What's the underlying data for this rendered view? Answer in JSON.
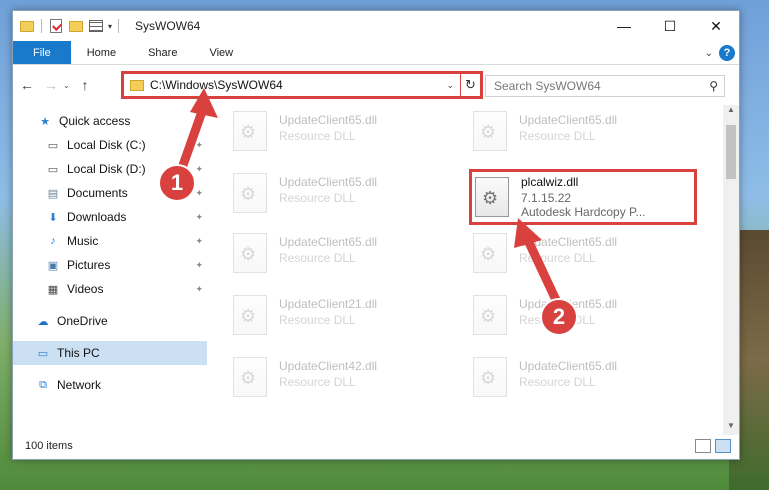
{
  "window": {
    "title": "SysWOW64",
    "controls": {
      "minimize": "—",
      "maximize": "☐",
      "close": "✕"
    }
  },
  "ribbon": {
    "tabs": [
      "File",
      "Home",
      "Share",
      "View"
    ],
    "help": "?"
  },
  "address": {
    "path": "C:\\Windows\\SysWOW64",
    "search_placeholder": "Search SysWOW64"
  },
  "nav_pane": {
    "items": [
      {
        "label": "Quick access",
        "icon": "star-icon"
      },
      {
        "label": "Local Disk (C:)",
        "icon": "drive-icon"
      },
      {
        "label": "Local Disk (D:)",
        "icon": "drive-icon"
      },
      {
        "label": "Documents",
        "icon": "documents-icon"
      },
      {
        "label": "Downloads",
        "icon": "downloads-icon"
      },
      {
        "label": "Music",
        "icon": "music-icon"
      },
      {
        "label": "Pictures",
        "icon": "pictures-icon"
      },
      {
        "label": "Videos",
        "icon": "videos-icon"
      },
      {
        "label": "OneDrive",
        "icon": "cloud-icon"
      },
      {
        "label": "This PC",
        "icon": "computer-icon",
        "selected": true
      },
      {
        "label": "Network",
        "icon": "network-icon"
      }
    ]
  },
  "files": [
    {
      "name": "UpdateClient65.dll",
      "type": "Resource DLL"
    },
    {
      "name": "UpdateClient65.dll",
      "type": "Resource DLL"
    },
    {
      "name": "UpdateClient65.dll",
      "type": "Resource DLL"
    },
    {
      "name": "plcalwiz.dll",
      "version": "7.1.15.22",
      "description": "Autodesk Hardcopy P..."
    },
    {
      "name": "UpdateClient65.dll",
      "type": "Resource DLL"
    },
    {
      "name": "UpdateClient65.dll",
      "type": "Resource DLL"
    },
    {
      "name": "UpdateClient21.dll",
      "type": "Resource DLL"
    },
    {
      "name": "UpdateClient65.dll",
      "type": "Resource DLL"
    },
    {
      "name": "UpdateClient42.dll",
      "type": "Resource DLL"
    },
    {
      "name": "UpdateClient65.dll",
      "type": "Resource DLL"
    }
  ],
  "status": {
    "item_count": "100 items"
  },
  "callouts": [
    "1",
    "2"
  ],
  "colors": {
    "accent": "#1979ca",
    "highlight": "#d9413e"
  }
}
